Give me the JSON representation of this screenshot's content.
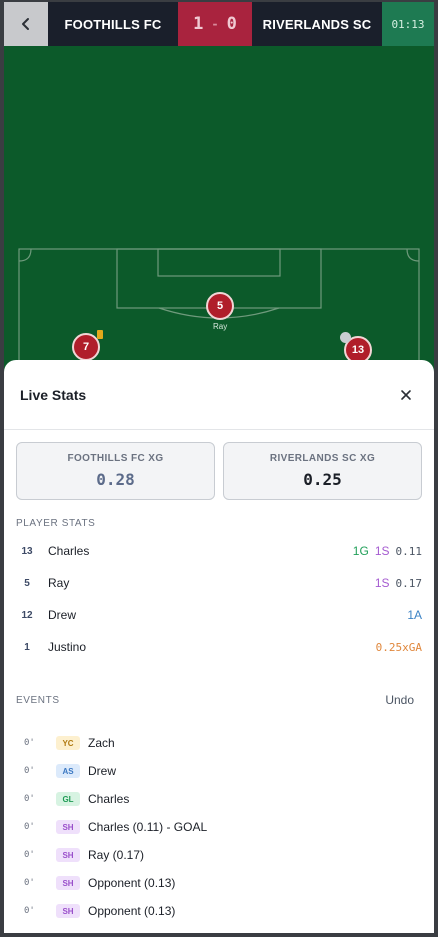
{
  "header": {
    "home_team": "FOOTHILLS FC",
    "away_team": "RIVERLANDS SC",
    "home_score": "1",
    "score_separator": "-",
    "away_score": "0",
    "clock": "01:13"
  },
  "pitch": {
    "players": [
      {
        "number": "5",
        "name": "Ray"
      },
      {
        "number": "7"
      },
      {
        "number": "13"
      }
    ]
  },
  "panel": {
    "title": "Live Stats",
    "xg": {
      "home_label": "FOOTHILLS FC XG",
      "home_value": "0.28",
      "away_label": "RIVERLANDS SC XG",
      "away_value": "0.25"
    },
    "player_stats_label": "PLAYER STATS",
    "players": [
      {
        "number": "13",
        "name": "Charles",
        "goals": "1G",
        "shots": "1S",
        "xg": "0.11"
      },
      {
        "number": "5",
        "name": "Ray",
        "shots": "1S",
        "xg": "0.17"
      },
      {
        "number": "12",
        "name": "Drew",
        "assists": "1A"
      },
      {
        "number": "1",
        "name": "Justino",
        "xga": "0.25xGA"
      }
    ],
    "events_label": "EVENTS",
    "undo_label": "Undo",
    "events": [
      {
        "minute": "0'",
        "type": "YC",
        "text": "Zach"
      },
      {
        "minute": "0'",
        "type": "AS",
        "text": "Drew"
      },
      {
        "minute": "0'",
        "type": "GL",
        "text": "Charles"
      },
      {
        "minute": "0'",
        "type": "SH",
        "text": "Charles (0.11) - GOAL"
      },
      {
        "minute": "0'",
        "type": "SH",
        "text": "Ray (0.17)"
      },
      {
        "minute": "0'",
        "type": "SH",
        "text": "Opponent (0.13)"
      },
      {
        "minute": "0'",
        "type": "SH",
        "text": "Opponent (0.13)"
      }
    ]
  },
  "colors": {
    "pitch": "#0c5a2a",
    "score_bg": "#a9233e",
    "clock_bg": "#1e7a52",
    "player_marker": "#b01e2a",
    "home_xg": "#5c6b8a",
    "away_xg": "#1b1f27"
  },
  "icons": {
    "back": "chevron-left-icon",
    "close": "close-icon"
  }
}
